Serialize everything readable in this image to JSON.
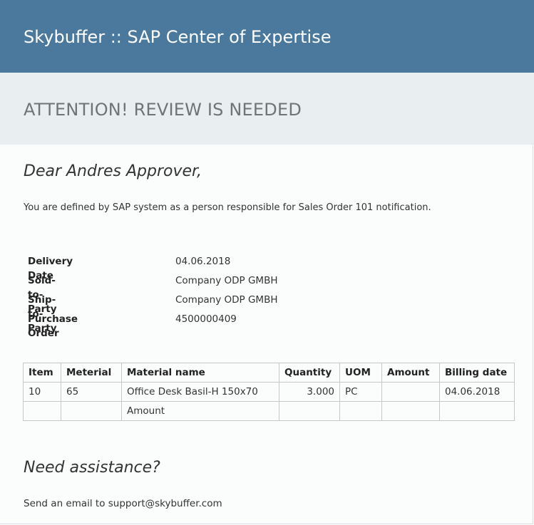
{
  "header": {
    "title": "Skybuffer :: SAP Center of Expertise"
  },
  "banner": {
    "title": "ATTENTION! REVIEW IS NEEDED"
  },
  "greeting": "Dear Andres Approver,",
  "intro": "You are defined by SAP system as a person responsible for Sales Order 101 notification.",
  "details": [
    {
      "label": "Delivery Date",
      "value": "04.06.2018"
    },
    {
      "label": "Sold-to-Party",
      "value": "Company ODP GMBH"
    },
    {
      "label": "Ship-to-Party",
      "value": "Company ODP GMBH"
    },
    {
      "label": "Purchase Order",
      "value": "4500000409"
    }
  ],
  "table": {
    "columns": [
      "Item",
      "Meterial",
      "Material name",
      "Quantity",
      "UOM",
      "Amount",
      "Billing date"
    ],
    "rows": [
      [
        "10",
        "65",
        "Office Desk Basil-H 150x70",
        "3.000",
        "PC",
        "",
        "04.06.2018"
      ],
      [
        "",
        "",
        "Amount",
        "",
        "",
        "",
        ""
      ]
    ]
  },
  "assistance": {
    "title": "Need assistance?",
    "text": "Send an email to support@skybuffer.com"
  },
  "colors": {
    "header_bg": "#4b799e",
    "banner_bg": "#e9eef0",
    "banner_text": "#6f7477"
  }
}
